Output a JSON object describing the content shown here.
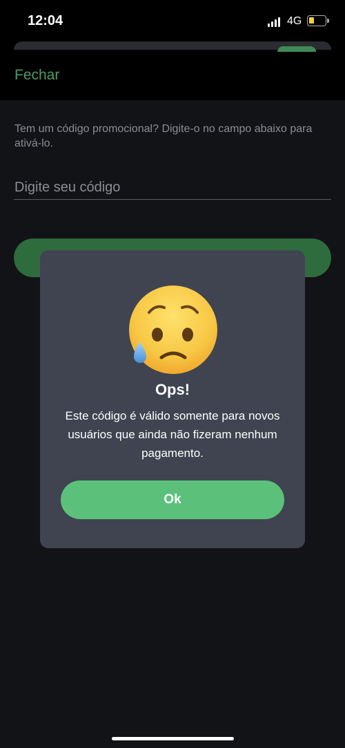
{
  "status_bar": {
    "time": "12:04",
    "network": "4G"
  },
  "header": {
    "close_label": "Fechar"
  },
  "promo": {
    "description": "Tem um código promocional? Digite-o no campo abaixo para ativá-lo.",
    "input_placeholder": "Digite seu código"
  },
  "dialog": {
    "icon": "sad-sweat-face-emoji",
    "title": "Ops!",
    "message": "Este código é válido somente para novos usuários que ainda não fizeram nenhum pagamento.",
    "ok_label": "Ok"
  },
  "colors": {
    "accent_green": "#5bc17a",
    "background": "#121317",
    "dialog_bg": "#3f4450"
  }
}
